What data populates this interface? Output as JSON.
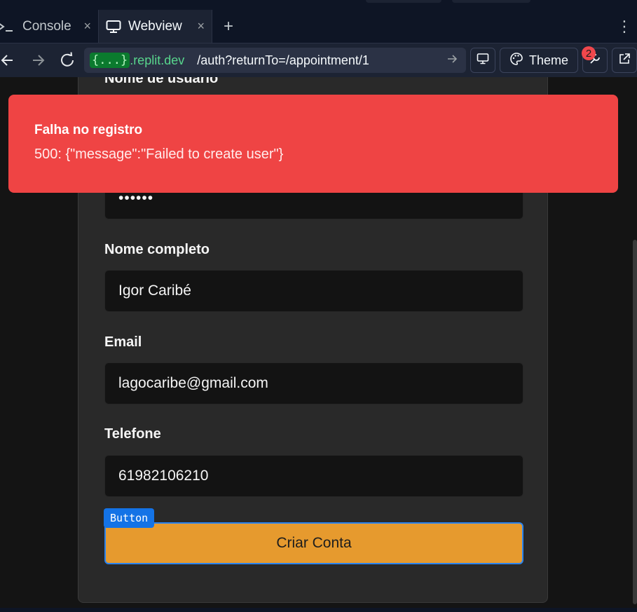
{
  "tabs": [
    {
      "label": "Console",
      "close": "×"
    },
    {
      "label": "Webview",
      "close": "×"
    }
  ],
  "tab_add": "+",
  "tab_menu": "⋮",
  "address": {
    "badge": "{...}",
    "host": ".replit.dev",
    "path": "/auth?returnTo=/appointment/1"
  },
  "toolbar": {
    "theme_label": "Theme",
    "notification_count": "2"
  },
  "form": {
    "username_label": "Nome de usuário",
    "password_dots": "••••••",
    "fullname_label": "Nome completo",
    "fullname_value": "Igor Caribé",
    "email_label": "Email",
    "email_value": "lagocaribe@gmail.com",
    "phone_label": "Telefone",
    "phone_value": "61982106210",
    "element_tag": "Button",
    "submit_label": "Criar Conta"
  },
  "toast": {
    "title": "Falha no registro",
    "description": "500: {\"message\":\"Failed to create user\"}"
  },
  "colors": {
    "toast_bg": "#ef4444",
    "submit_bg": "#e69a2e",
    "accent_blue": "#1473e6",
    "host_green": "#58d68d"
  }
}
